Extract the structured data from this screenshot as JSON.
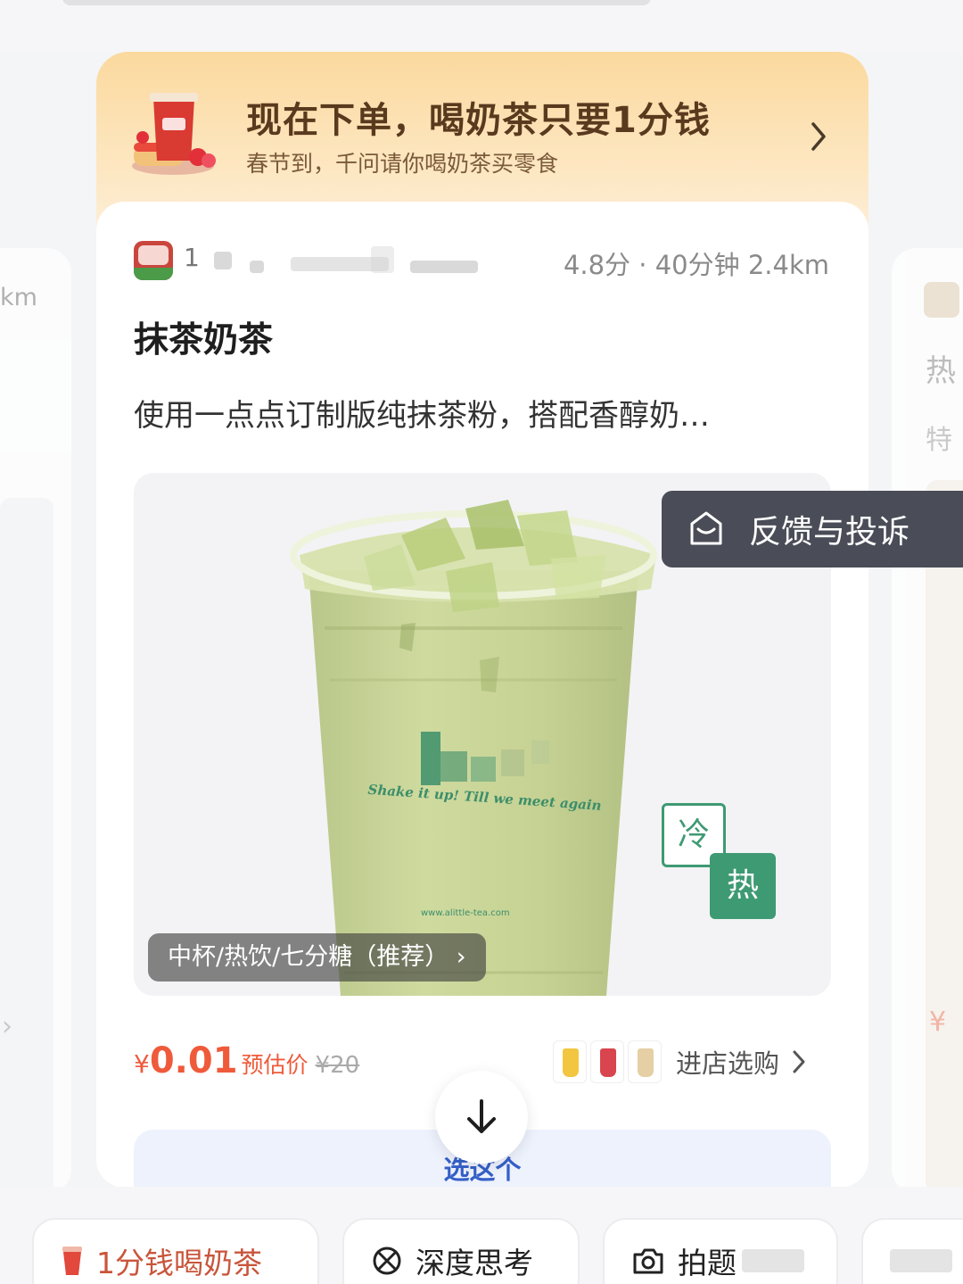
{
  "promo": {
    "title": "现在下单，喝奶茶只要1分钱",
    "subtitle": "春节到，千问请你喝奶茶买零食"
  },
  "store": {
    "name_visible": "1",
    "meta": "4.8分 · 40分钟 2.4km"
  },
  "product": {
    "title": "抹茶奶茶",
    "description": "使用一点点订制版纯抹茶粉，搭配香醇奶…",
    "spec": "中杯/热饮/七分糖（推荐）",
    "temp_cold": "冷",
    "temp_hot": "热",
    "cup_slogan": "Shake it up! Till we meet again",
    "cup_url": "www.alittle-tea.com"
  },
  "price": {
    "currency": "¥",
    "value": "0.01",
    "label": "预估价",
    "original": "¥20"
  },
  "enter_store": {
    "label": "进店选购"
  },
  "choose_button": {
    "label": "选这个"
  },
  "feedback": {
    "label": "反馈与投诉"
  },
  "side_cards": {
    "left_distance": "km",
    "right_title": "热",
    "right_subtitle": "特",
    "right_price": "¥"
  },
  "bottom_chips": [
    {
      "label": "1分钱喝奶茶"
    },
    {
      "label": "深度思考"
    },
    {
      "label": "拍题"
    }
  ],
  "colors": {
    "accent_green": "#3e9a73",
    "price_red": "#ef5a3a",
    "choose_blue": "#3560c8",
    "promo_bg": "#fbd99e"
  },
  "icons": [
    "drink-cup-icon",
    "chevron-right-icon",
    "feedback-icon",
    "arrow-down-icon",
    "brain-icon",
    "camera-icon"
  ]
}
